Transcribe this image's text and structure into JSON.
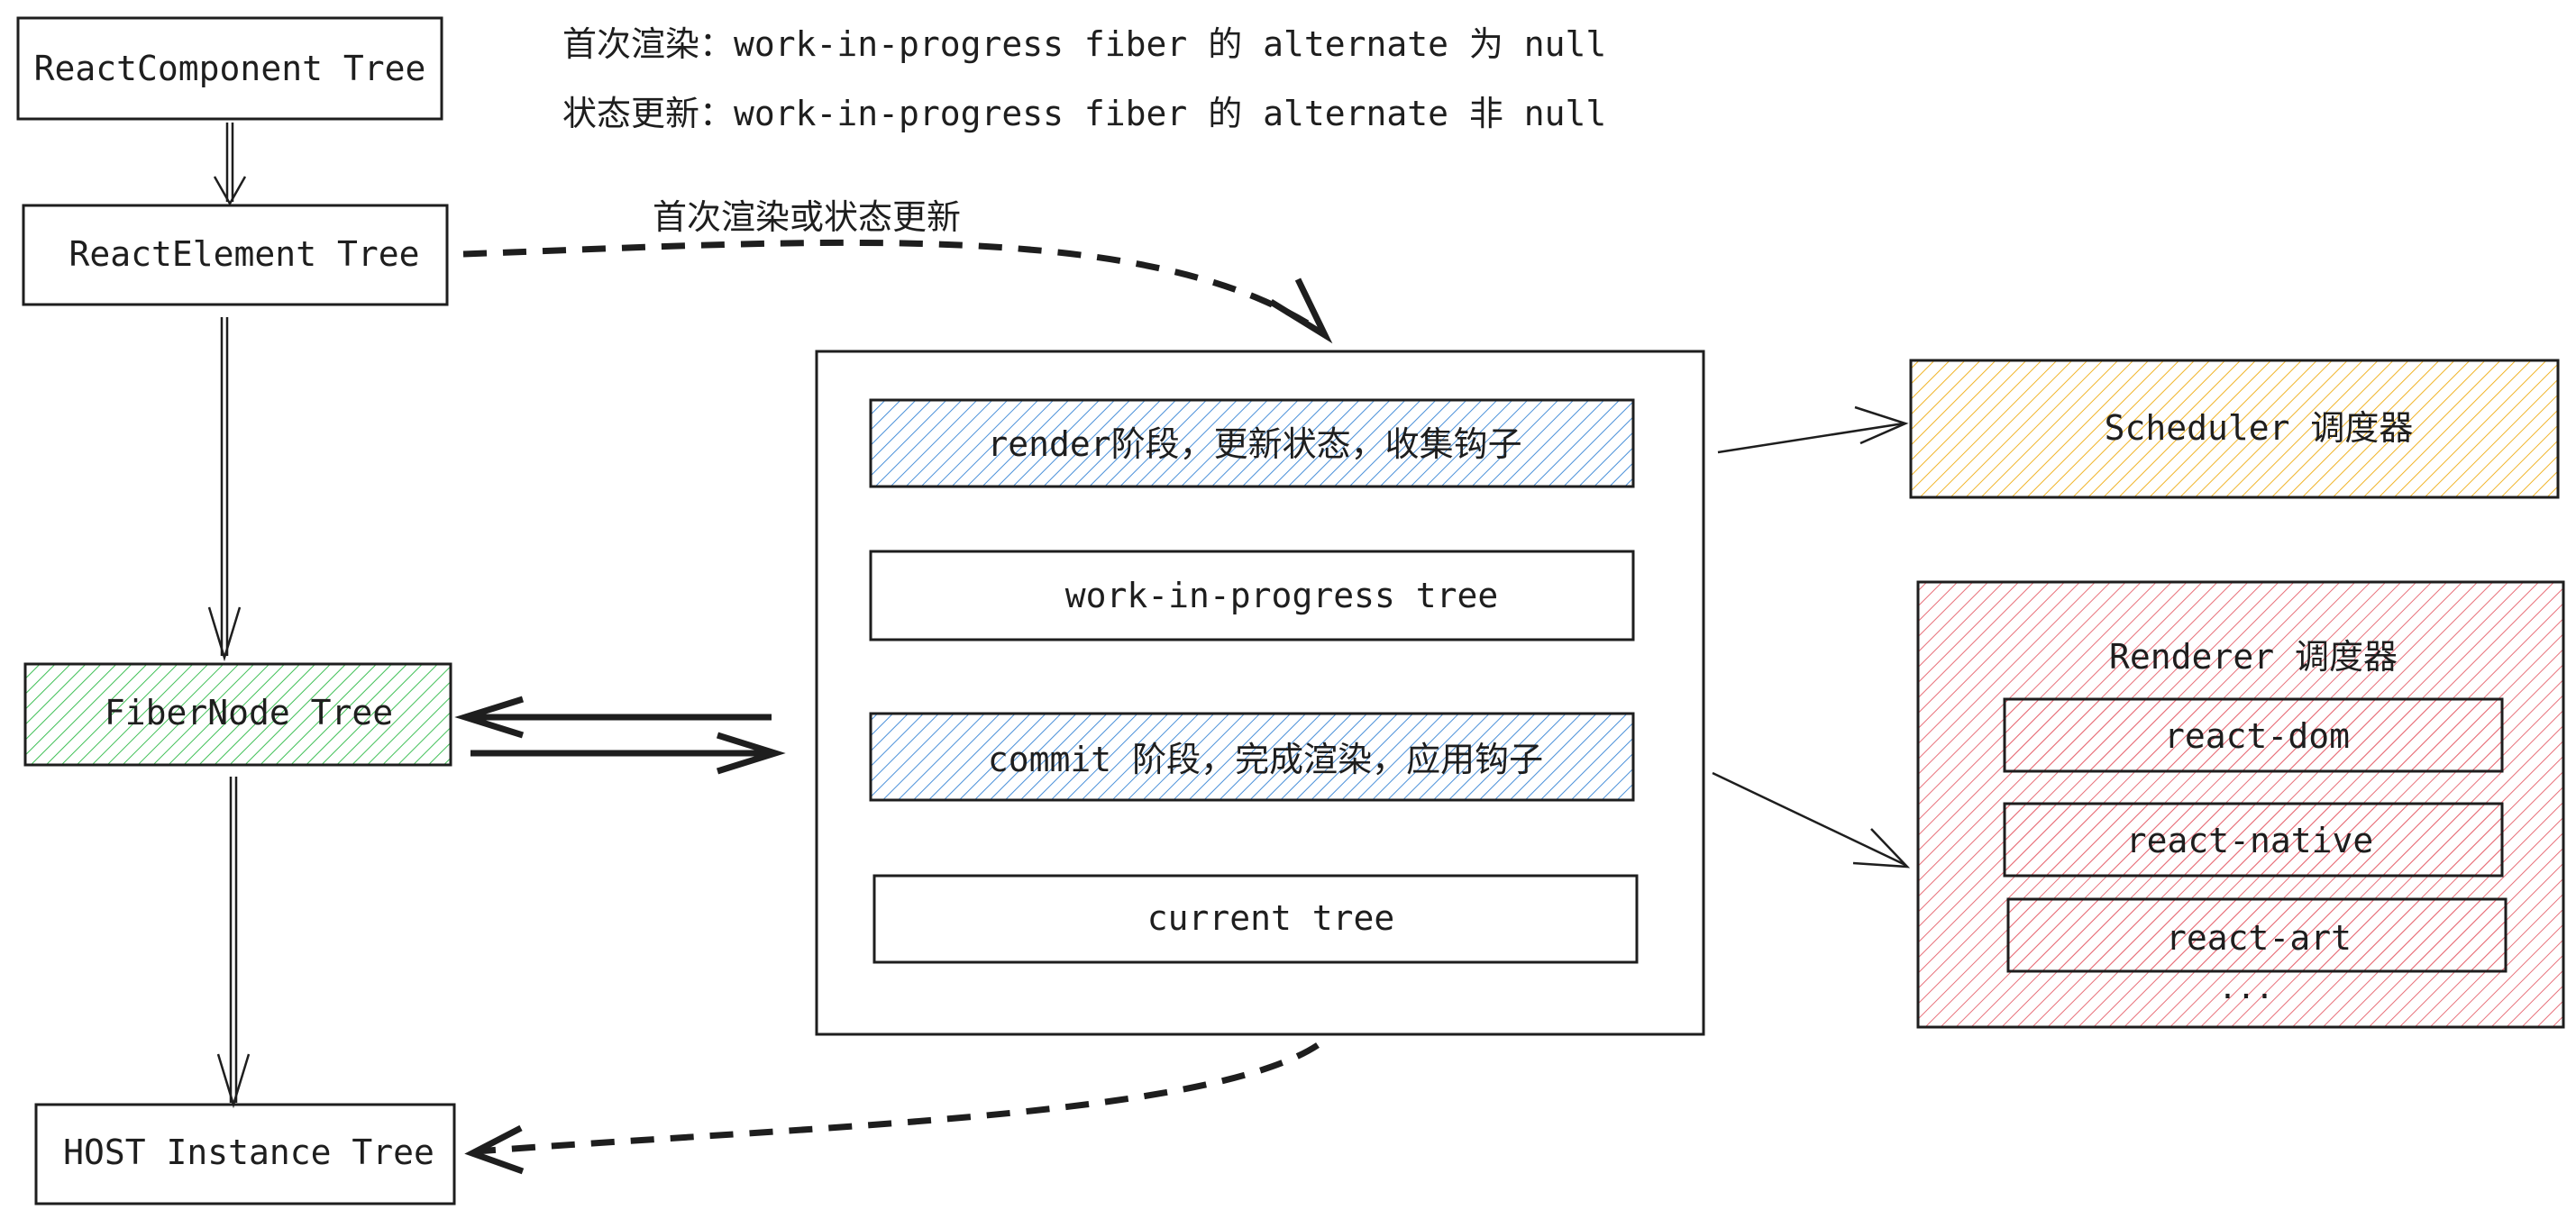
{
  "notes": {
    "first_render": "首次渲染：work-in-progress fiber 的 alternate 为 null",
    "state_update": "状态更新：work-in-progress fiber 的 alternate 非 null"
  },
  "edge_label": "首次渲染或状态更新",
  "nodes": {
    "react_component_tree": "ReactComponent Tree",
    "react_element_tree": "ReactElement Tree",
    "fibernode_tree": "FiberNode Tree",
    "host_instance_tree": "HOST Instance Tree"
  },
  "reconciler": {
    "render_phase": "render阶段，更新状态，收集钩子",
    "wip_tree": "work-in-progress tree",
    "commit_phase": "commit 阶段，完成渲染，应用钩子",
    "current_tree": "current tree"
  },
  "scheduler": {
    "label": "Scheduler 调度器"
  },
  "renderer": {
    "label": "Renderer 调度器",
    "items": [
      "react-dom",
      "react-native",
      "react-art"
    ],
    "more": "..."
  },
  "colors": {
    "stroke": "#1e1e1e",
    "blue_hatch": "#4a90d9",
    "green_hatch": "#40c057",
    "yellow_hatch": "#f0b429",
    "red_hatch": "#e8707a"
  }
}
